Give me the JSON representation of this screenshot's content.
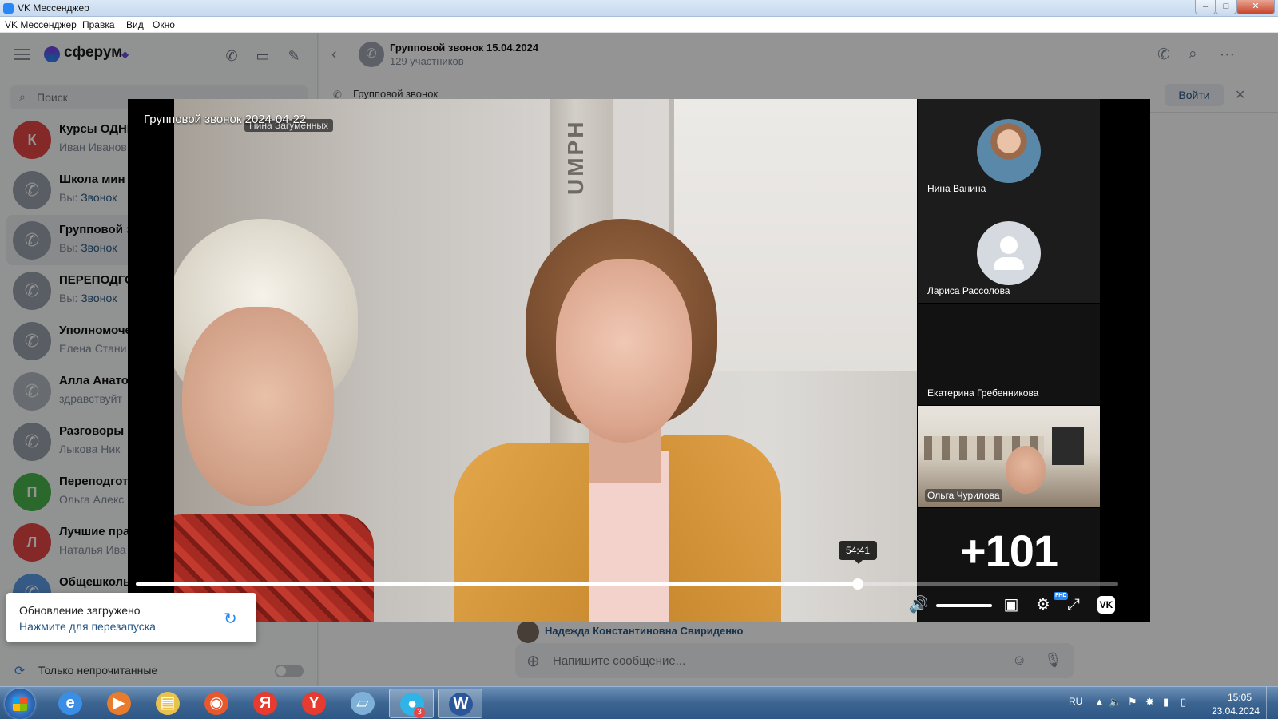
{
  "window": {
    "title": "VK Мессенджер",
    "min_glyph": "–",
    "max_glyph": "□",
    "close_glyph": "✕"
  },
  "menu": [
    "VK Мессенджер",
    "Правка",
    "Вид",
    "Окно"
  ],
  "sidebar": {
    "brand": "сферум",
    "search_placeholder": "Поиск",
    "chats": [
      {
        "initial": "К",
        "name": "Курсы ОДНК",
        "sub": "Иван Иванов",
        "highlight": "",
        "color": "#e64646"
      },
      {
        "initial": "",
        "name": "Школа мин",
        "sub": "Вы: ",
        "highlight": "Звонок",
        "color": "#9aa3ad"
      },
      {
        "initial": "",
        "name": "Групповой з",
        "sub": "Вы: ",
        "highlight": "Звонок",
        "color": "#9aa3ad"
      },
      {
        "initial": "",
        "name": "ПЕРЕПОДГО",
        "sub": "Вы: ",
        "highlight": "Звонок",
        "color": "#9aa3ad"
      },
      {
        "initial": "",
        "name": "Уполномоче",
        "sub": "Елена Стани",
        "highlight": "",
        "color": "#9aa3ad"
      },
      {
        "initial": "",
        "name": "Алла Анатол",
        "sub": "здравствуйт",
        "highlight": "",
        "color": "#b3bac2"
      },
      {
        "initial": "",
        "name": "Разговоры о",
        "sub": "Лыкова Ник",
        "highlight": "",
        "color": "#9aa3ad"
      },
      {
        "initial": "П",
        "name": "Переподгот",
        "sub": "Ольга Алекс",
        "highlight": "",
        "color": "#4bb34b"
      },
      {
        "initial": "Л",
        "name": "Лучшие пра",
        "sub": "Наталья Ива",
        "highlight": "",
        "color": "#e64646"
      },
      {
        "initial": "",
        "name": "Общешколь",
        "sub": "",
        "highlight": "",
        "color": "#5c9ce6"
      }
    ],
    "unread_only_label": "Только непрочитанные"
  },
  "chat": {
    "title": "Групповой звонок 15.04.2024",
    "members": "129 участников",
    "pinned_text": "Групповой звонок",
    "join_label": "Войти",
    "last_author": "Надежда Константиновна Свириденко",
    "composer_placeholder": "Напишите сообщение..."
  },
  "player": {
    "title": "Групповой звонок 2024-04-22",
    "speaker_tag": "Нина Загуменных",
    "door_text": "UMPH",
    "participants": [
      {
        "name": "Нина Ванина",
        "type": "photo"
      },
      {
        "name": "Лариса Рассолова",
        "type": "blank"
      },
      {
        "name": "Екатерина Гребенникова",
        "type": "none"
      },
      {
        "name": "Ольга Чурилова",
        "type": "cam"
      }
    ],
    "more_count": "+101",
    "hover_time": "54:41",
    "progress": 0.735,
    "volume": 1.0,
    "hd_badge": "FHD",
    "vk_glyph": "VK"
  },
  "toast": {
    "title": "Обновление загружено",
    "action": "Нажмите для перезапуска"
  },
  "taskbar": {
    "apps": [
      {
        "id": "ie",
        "glyph": "e",
        "color": "#3a8ee6"
      },
      {
        "id": "media",
        "glyph": "▶",
        "color": "#e87b2c"
      },
      {
        "id": "explorer",
        "glyph": "▤",
        "color": "#e8c24a"
      },
      {
        "id": "firefox",
        "glyph": "◉",
        "color": "#e8582c"
      },
      {
        "id": "yandex",
        "glyph": "Я",
        "color": "#e63b2e"
      },
      {
        "id": "yandex-browser",
        "glyph": "Y",
        "color": "#e63b2e"
      },
      {
        "id": "notes",
        "glyph": "▱",
        "color": "#7fb1d8"
      },
      {
        "id": "messenger",
        "glyph": "●",
        "color": "#2fb4e8",
        "badge": "3"
      },
      {
        "id": "word",
        "glyph": "W",
        "color": "#2b579a"
      }
    ],
    "lang": "RU",
    "time": "15:05",
    "date": "23.04.2024"
  }
}
